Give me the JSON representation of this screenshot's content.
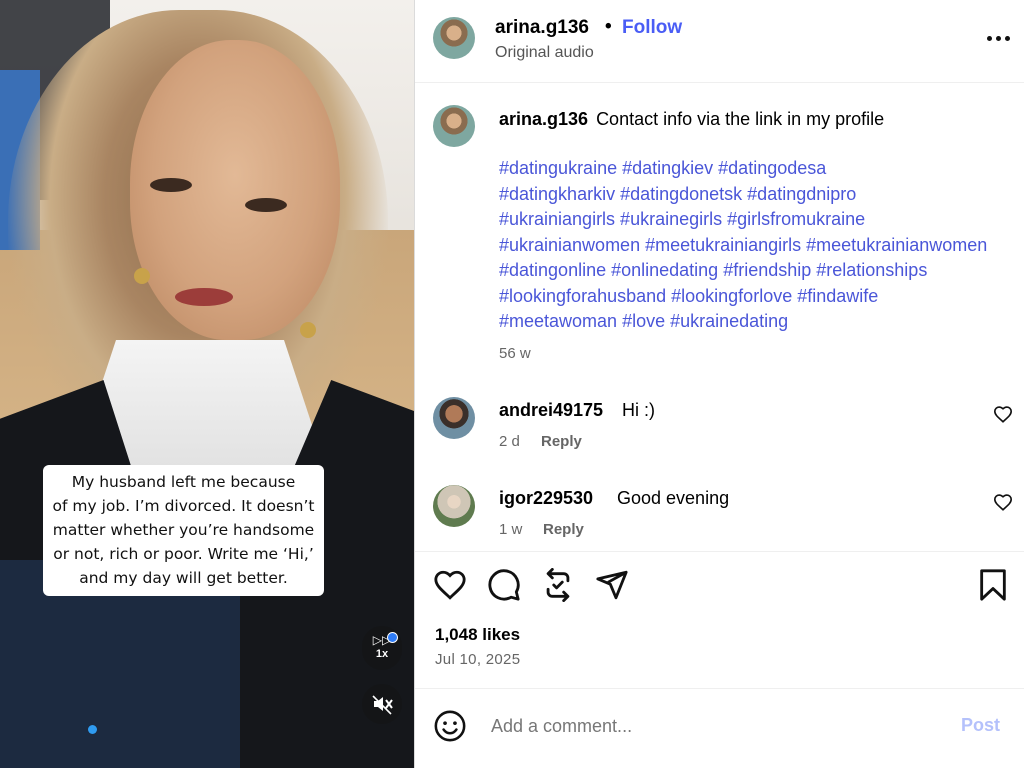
{
  "media": {
    "caption_lines": [
      "My husband left me because",
      "of my job. I’m divorced. It doesn’t",
      "matter whether you’re handsome",
      "or not, rich or poor. Write me ‘Hi,’",
      "and my day will get better."
    ],
    "playback_rate": "1x",
    "icons": {
      "speed": "fast-forward-icon",
      "mute": "speaker-muted-icon"
    }
  },
  "header": {
    "username": "arina.g136",
    "separator": "•",
    "follow_label": "Follow",
    "audio_label": "Original audio",
    "more_icon": "more-options-icon"
  },
  "post": {
    "username": "arina.g136",
    "text": "Contact info via the link in my profile",
    "hashtag_lines": [
      "#datingukraine #datingkiev #datingodesa",
      "#datingkharkiv #datingdonetsk #datingdnipro",
      "#ukrainiangirls #ukrainegirls #girlsfromukraine",
      "#ukrainianwomen #meetukrainiangirls #meetukrainianwomen",
      "#datingonline #onlinedating #friendship #relationships",
      "#lookingforahusband #lookingforlove #findawife",
      "#meetawoman #love #ukrainedating"
    ],
    "age": "56 w"
  },
  "comments": [
    {
      "username": "andrei49175",
      "text": "Hi :)",
      "time": "2 d",
      "reply_label": "Reply"
    },
    {
      "username": "igor229530",
      "text": "Good evening",
      "time": "1 w",
      "reply_label": "Reply"
    }
  ],
  "actions": {
    "icons": [
      "like-icon",
      "comment-icon",
      "repost-icon",
      "share-icon",
      "save-icon"
    ],
    "likes": "1,048 likes",
    "date": "Jul 10, 2025"
  },
  "comment_box": {
    "placeholder": "Add a comment...",
    "post_label": "Post"
  },
  "colors": {
    "accent": "#4a5df5",
    "hashtag": "#4a56d8",
    "post_disabled": "#b4c1fb",
    "progress": "#2f9bf0"
  }
}
